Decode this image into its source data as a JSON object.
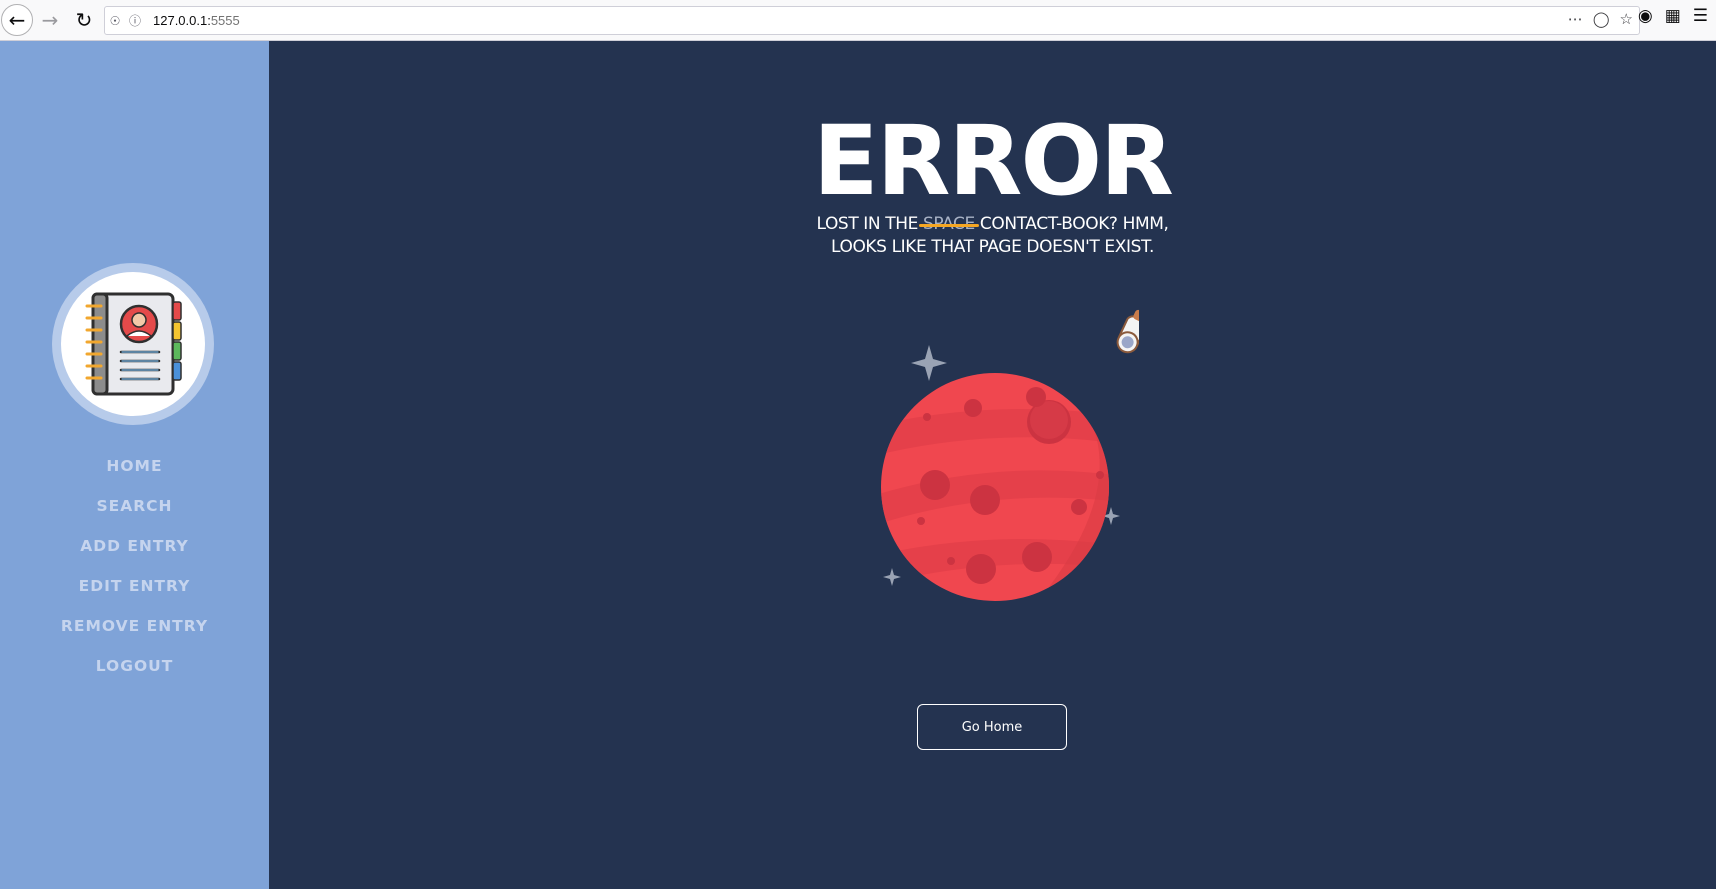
{
  "browser": {
    "url_host": "127.0.0.1:",
    "url_port": "5555"
  },
  "sidebar": {
    "items": [
      {
        "label": "HOME"
      },
      {
        "label": "SEARCH"
      },
      {
        "label": "ADD ENTRY"
      },
      {
        "label": "EDIT ENTRY"
      },
      {
        "label": "REMOVE ENTRY"
      },
      {
        "label": "LOGOUT"
      }
    ]
  },
  "main": {
    "title": "ERROR",
    "subtitle_before": "LOST IN THE ",
    "subtitle_struck": "SPACE",
    "subtitle_after": " CONTACT-BOOK? HMM,",
    "subtitle_line2": "LOOKS LIKE THAT PAGE DOESN'T EXIST.",
    "button_label": "Go Home"
  },
  "colors": {
    "sidebar_bg": "#7fa3d8",
    "main_bg": "#243350",
    "planet": "#f0474f",
    "strike": "#f5a623"
  }
}
